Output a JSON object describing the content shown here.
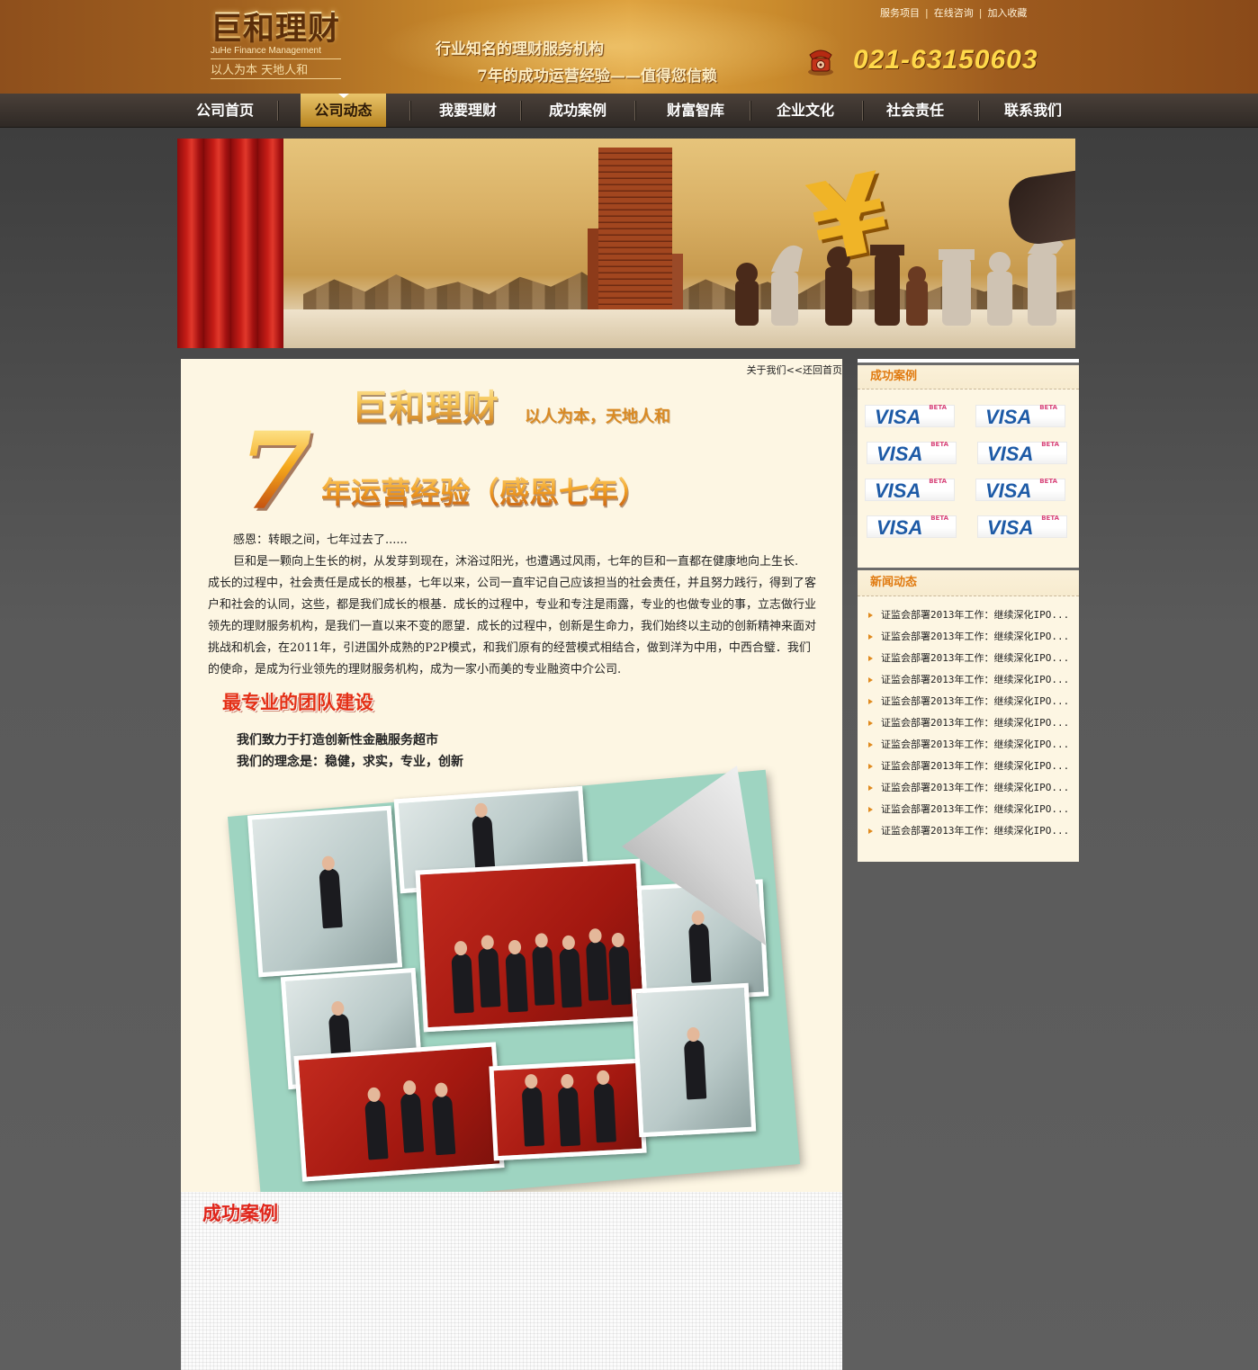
{
  "header": {
    "logo_title": "巨和理财",
    "logo_en": "JuHe Finance Management",
    "logo_slogan": "以人为本  天地人和",
    "slogan_line1": "行业知名的理财服务机构",
    "slogan_line2": "7年的成功运营经验——值得您信赖",
    "phone": "021-63150603",
    "phone_icon": "telephone-icon",
    "top_links": [
      "服务项目",
      "在线咨询",
      "加入收藏"
    ],
    "top_link_separator": "|"
  },
  "nav": {
    "items": [
      {
        "label": "公司首页"
      },
      {
        "label": "公司动态",
        "active": true
      },
      {
        "label": "我要理财"
      },
      {
        "label": "成功案例"
      },
      {
        "label": "财富智库"
      },
      {
        "label": "企业文化"
      },
      {
        "label": "社会责任"
      },
      {
        "label": "联系我们"
      }
    ]
  },
  "main": {
    "breadcrumb_current": "关于我们",
    "breadcrumb_sep": "<<",
    "breadcrumb_back": "还回首页",
    "brand_title": "巨和理财",
    "brand_sub": "以人为本，天地人和",
    "seven_number": "7",
    "seven_text": "年运营经验（感恩七年）",
    "intro": [
      "感恩：转眼之间，七年过去了......",
      "巨和是一颗向上生长的树，从发芽到现在，沐浴过阳光，也遭遇过风雨，七年的巨和一直都在健康地向上生长.",
      "成长的过程中，社会责任是成长的根基，七年以来，公司一直牢记自己应该担当的社会责任，并且努力践行，得到了客户和社会的认同，这些，都是我们成长的根基．成长的过程中，专业和专注是雨露，专业的也做专业的事，立志做行业领先的理财服务机构，是我们一直以来不变的愿望．成长的过程中，创新是生命力，我们始终以主动的创新精神来面对挑战和机会，在2011年，引进国外成熟的P2P模式，和我们原有的经营模式相结合，做到洋为中用，中西合璧．我们的使命，是成为行业领先的理财服务机构，成为一家小而美的专业融资中介公司."
    ],
    "team_heading": "最专业的团队建设",
    "mission_line1": "我们致力于打造创新性金融服务超市",
    "mission_line2": "我们的理念是：稳健，求实，专业，创新",
    "cases_title": "成功案例"
  },
  "sidebar": {
    "cases_title": "成功案例",
    "logo_text": "VISA",
    "logo_badge": "BETA",
    "cases_count": 8,
    "news_title": "新闻动态",
    "news_items": [
      "证监会部署2013年工作：继续深化IPO...",
      "证监会部署2013年工作：继续深化IPO...",
      "证监会部署2013年工作：继续深化IPO...",
      "证监会部署2013年工作：继续深化IPO...",
      "证监会部署2013年工作：继续深化IPO...",
      "证监会部署2013年工作：继续深化IPO...",
      "证监会部署2013年工作：继续深化IPO...",
      "证监会部署2013年工作：继续深化IPO...",
      "证监会部署2013年工作：继续深化IPO...",
      "证监会部署2013年工作：继续深化IPO...",
      "证监会部署2013年工作：继续深化IPO..."
    ]
  },
  "colors": {
    "header_brown": "#8e4f1c",
    "gold": "#dfa340",
    "nav_dark": "#2f2925",
    "nav_active": "#d6a43c",
    "content_bg": "#fdf6e3",
    "accent_orange": "#e07a10",
    "heading_red": "#e43016",
    "visa_blue": "#1d5aa6"
  }
}
